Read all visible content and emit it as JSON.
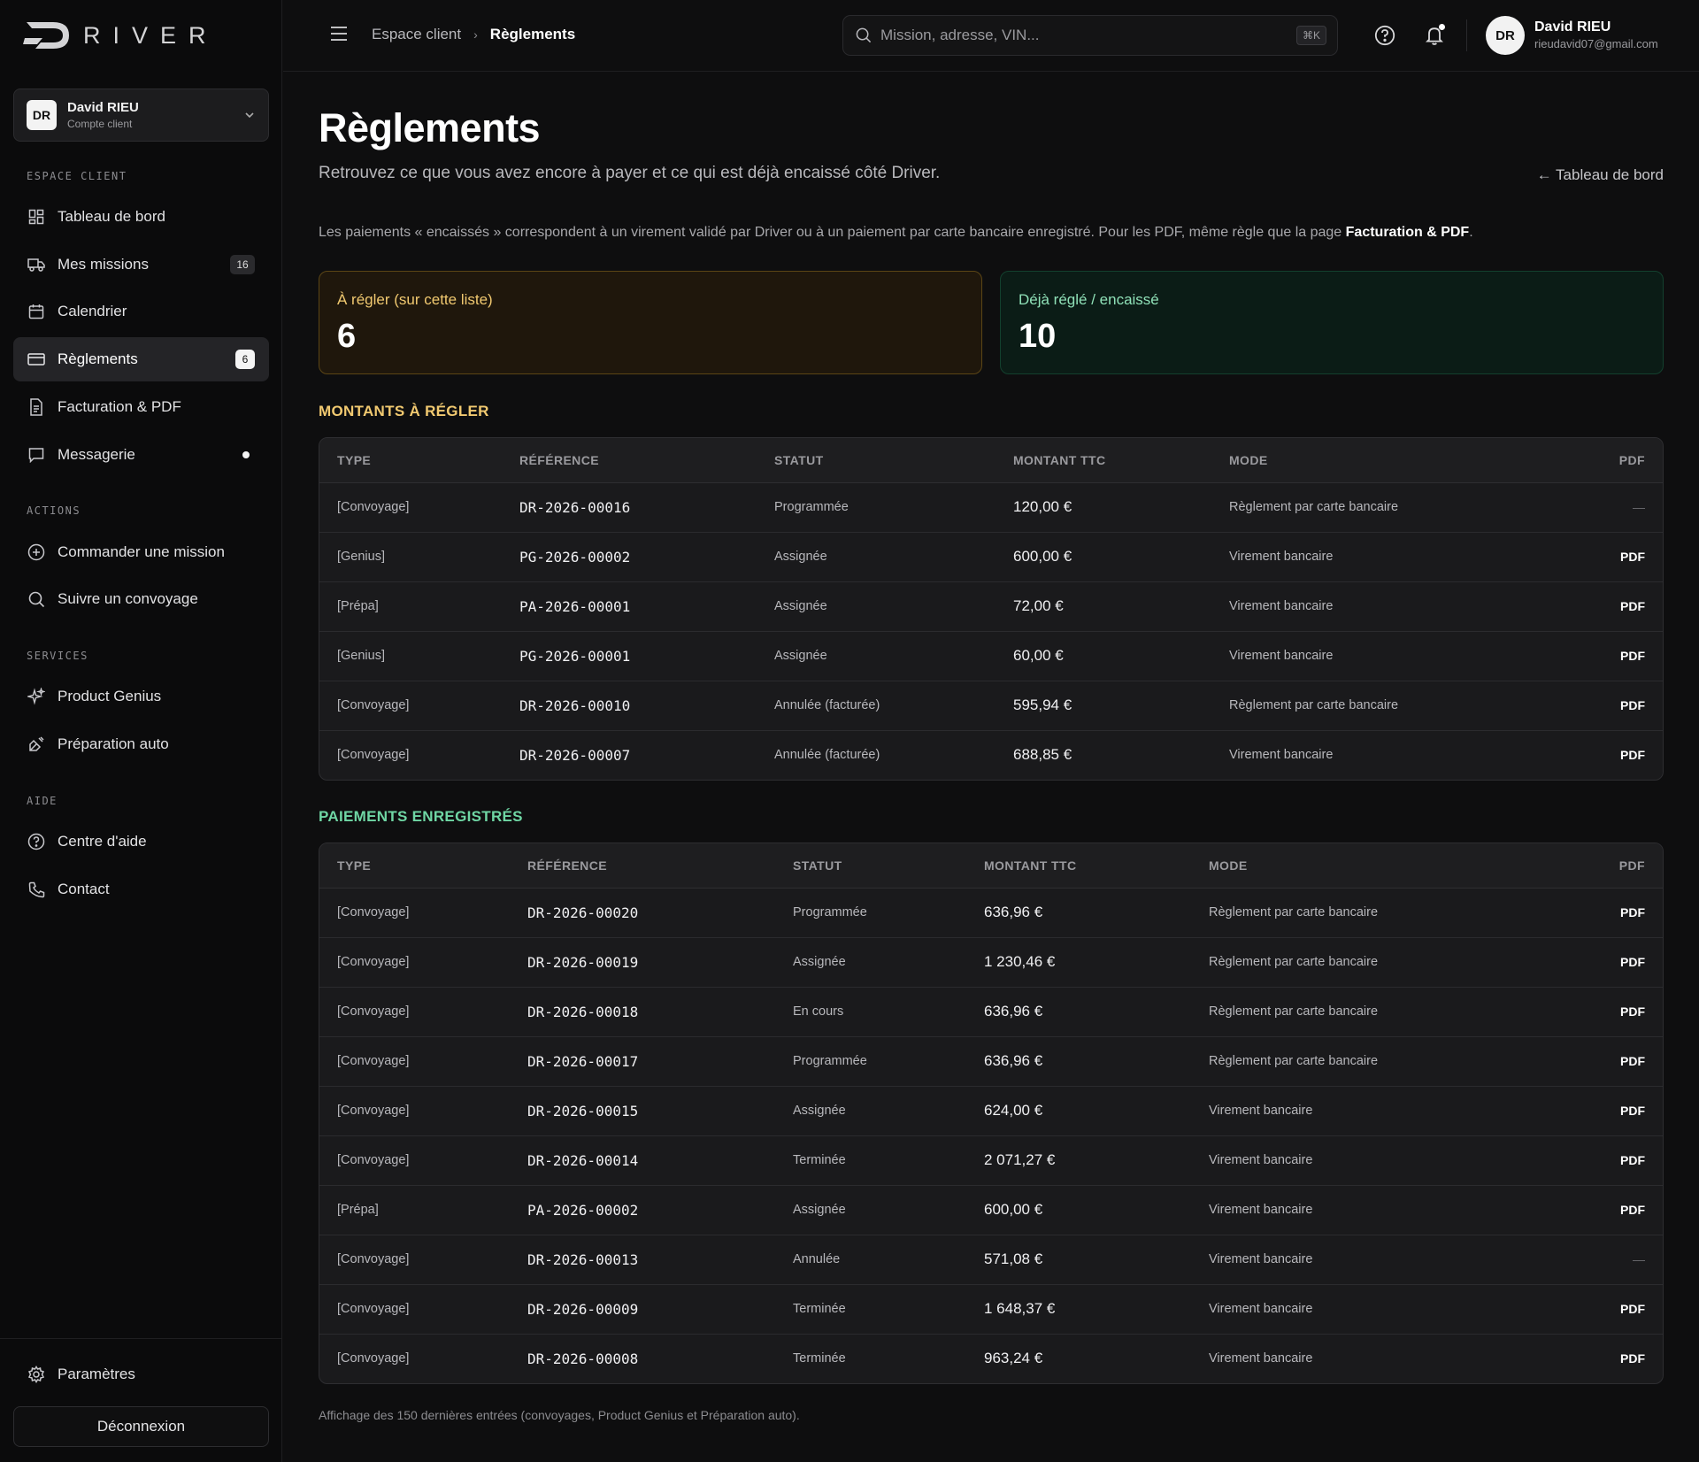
{
  "brand": {
    "logo_text": "RIVER"
  },
  "account": {
    "initials": "DR",
    "name": "David RIEU",
    "subtitle": "Compte client"
  },
  "sidebar": {
    "sections": {
      "espace": "ESPACE CLIENT",
      "actions": "ACTIONS",
      "services": "SERVICES",
      "aide": "AIDE"
    },
    "items": [
      {
        "label": "Tableau de bord",
        "icon": "dashboard-icon"
      },
      {
        "label": "Mes missions",
        "icon": "truck-icon",
        "badge": "16"
      },
      {
        "label": "Calendrier",
        "icon": "calendar-icon"
      },
      {
        "label": "Règlements",
        "icon": "credit-card-icon",
        "badge": "6",
        "active": true
      },
      {
        "label": "Facturation & PDF",
        "icon": "document-icon"
      },
      {
        "label": "Messagerie",
        "icon": "chat-icon",
        "dot": true
      },
      {
        "label": "Commander une mission",
        "icon": "plus-circle-icon"
      },
      {
        "label": "Suivre un convoyage",
        "icon": "search-icon"
      },
      {
        "label": "Product Genius",
        "icon": "sparkles-icon"
      },
      {
        "label": "Préparation auto",
        "icon": "spray-icon"
      },
      {
        "label": "Centre d'aide",
        "icon": "help-circle-icon"
      },
      {
        "label": "Contact",
        "icon": "phone-icon"
      }
    ],
    "settings_label": "Paramètres",
    "logout_label": "Déconnexion"
  },
  "topbar": {
    "breadcrumb": [
      "Espace client",
      "Règlements"
    ],
    "search_placeholder": "Mission, adresse, VIN...",
    "search_shortcut": "⌘K",
    "user": {
      "initials": "DR",
      "name": "David RIEU",
      "email": "rieudavid07@gmail.com"
    }
  },
  "page": {
    "title": "Règlements",
    "subtitle": "Retrouvez ce que vous avez encore à payer et ce qui est déjà encaissé côté Driver.",
    "back_link": "← Tableau de bord",
    "info_prefix": "Les paiements « encaissés » correspondent à un virement validé par Driver ou à un paiement par carte bancaire enregistré. Pour les PDF, même règle que la page ",
    "info_link": "Facturation & PDF",
    "info_suffix": ".",
    "stats": {
      "pending_label": "À régler (sur cette liste)",
      "pending_value": "6",
      "paid_label": "Déjà réglé / encaissé",
      "paid_value": "10"
    },
    "pending_section_title": "MONTANTS À RÉGLER",
    "paid_section_title": "PAIEMENTS ENREGISTRÉS",
    "columns": [
      "TYPE",
      "RÉFÉRENCE",
      "STATUT",
      "MONTANT TTC",
      "MODE",
      "PDF"
    ],
    "pending_rows": [
      {
        "type": "[Convoyage]",
        "ref": "DR-2026-00016",
        "status": "Programmée",
        "amount": "120,00 €",
        "mode": "Règlement par carte bancaire",
        "pdf": "—"
      },
      {
        "type": "[Genius]",
        "ref": "PG-2026-00002",
        "status": "Assignée",
        "amount": "600,00 €",
        "mode": "Virement bancaire",
        "pdf": "PDF"
      },
      {
        "type": "[Prépa]",
        "ref": "PA-2026-00001",
        "status": "Assignée",
        "amount": "72,00 €",
        "mode": "Virement bancaire",
        "pdf": "PDF"
      },
      {
        "type": "[Genius]",
        "ref": "PG-2026-00001",
        "status": "Assignée",
        "amount": "60,00 €",
        "mode": "Virement bancaire",
        "pdf": "PDF"
      },
      {
        "type": "[Convoyage]",
        "ref": "DR-2026-00010",
        "status": "Annulée (facturée)",
        "amount": "595,94 €",
        "mode": "Règlement par carte bancaire",
        "pdf": "PDF"
      },
      {
        "type": "[Convoyage]",
        "ref": "DR-2026-00007",
        "status": "Annulée (facturée)",
        "amount": "688,85 €",
        "mode": "Virement bancaire",
        "pdf": "PDF"
      }
    ],
    "paid_rows": [
      {
        "type": "[Convoyage]",
        "ref": "DR-2026-00020",
        "status": "Programmée",
        "amount": "636,96 €",
        "mode": "Règlement par carte bancaire",
        "pdf": "PDF"
      },
      {
        "type": "[Convoyage]",
        "ref": "DR-2026-00019",
        "status": "Assignée",
        "amount": "1 230,46 €",
        "mode": "Règlement par carte bancaire",
        "pdf": "PDF"
      },
      {
        "type": "[Convoyage]",
        "ref": "DR-2026-00018",
        "status": "En cours",
        "amount": "636,96 €",
        "mode": "Règlement par carte bancaire",
        "pdf": "PDF"
      },
      {
        "type": "[Convoyage]",
        "ref": "DR-2026-00017",
        "status": "Programmée",
        "amount": "636,96 €",
        "mode": "Règlement par carte bancaire",
        "pdf": "PDF"
      },
      {
        "type": "[Convoyage]",
        "ref": "DR-2026-00015",
        "status": "Assignée",
        "amount": "624,00 €",
        "mode": "Virement bancaire",
        "pdf": "PDF"
      },
      {
        "type": "[Convoyage]",
        "ref": "DR-2026-00014",
        "status": "Terminée",
        "amount": "2 071,27 €",
        "mode": "Virement bancaire",
        "pdf": "PDF"
      },
      {
        "type": "[Prépa]",
        "ref": "PA-2026-00002",
        "status": "Assignée",
        "amount": "600,00 €",
        "mode": "Virement bancaire",
        "pdf": "PDF"
      },
      {
        "type": "[Convoyage]",
        "ref": "DR-2026-00013",
        "status": "Annulée",
        "amount": "571,08 €",
        "mode": "Virement bancaire",
        "pdf": "—"
      },
      {
        "type": "[Convoyage]",
        "ref": "DR-2026-00009",
        "status": "Terminée",
        "amount": "1 648,37 €",
        "mode": "Virement bancaire",
        "pdf": "PDF"
      },
      {
        "type": "[Convoyage]",
        "ref": "DR-2026-00008",
        "status": "Terminée",
        "amount": "963,24 €",
        "mode": "Virement bancaire",
        "pdf": "PDF"
      }
    ],
    "footer_note": "Affichage des 150 dernières entrées (convoyages, Product Genius et Préparation auto)."
  }
}
